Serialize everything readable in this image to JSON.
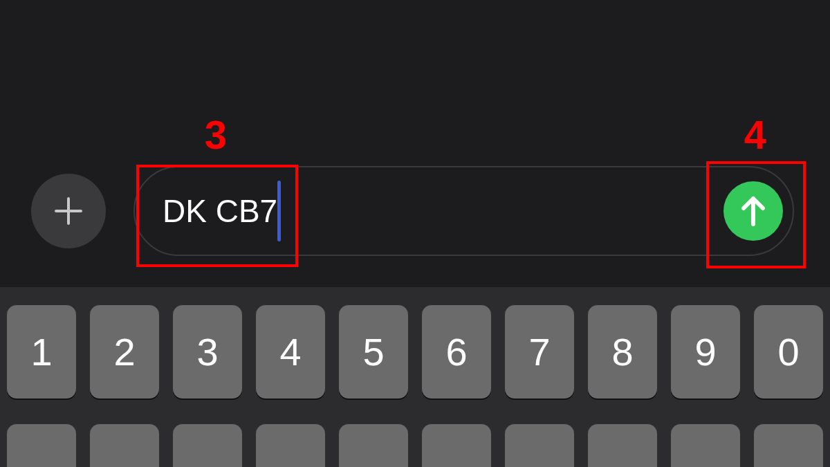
{
  "composer": {
    "value": "DK CB7",
    "focused": true
  },
  "keyboard": {
    "number_row": [
      "1",
      "2",
      "3",
      "4",
      "5",
      "6",
      "7",
      "8",
      "9",
      "0"
    ]
  },
  "annotations": [
    {
      "label": "3"
    },
    {
      "label": "4"
    }
  ]
}
